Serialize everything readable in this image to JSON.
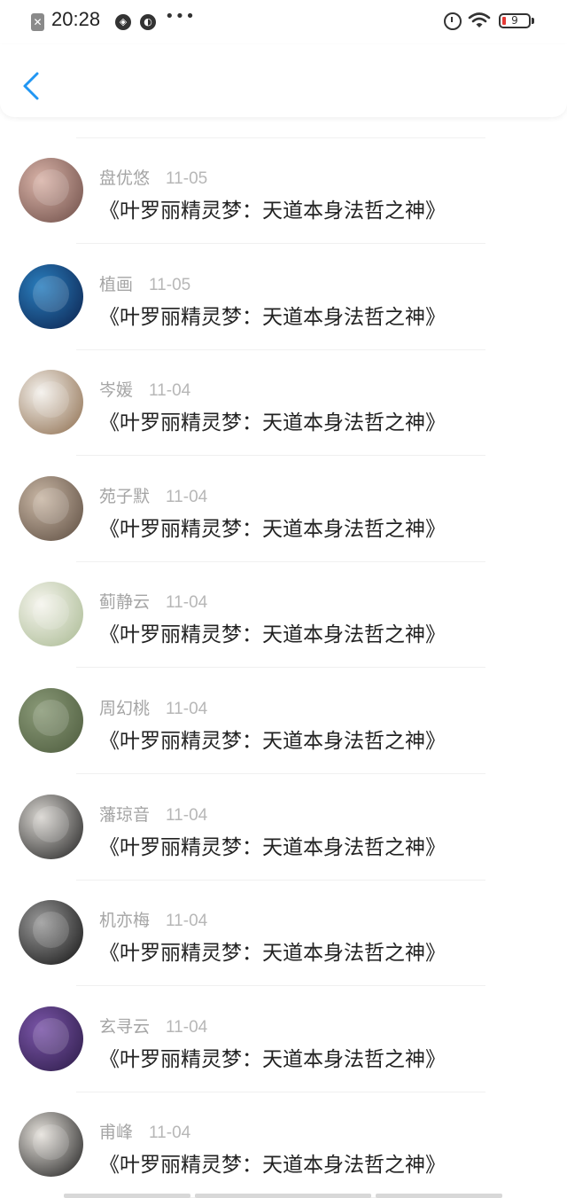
{
  "status_bar": {
    "time": "20:28",
    "battery": "9",
    "icons": [
      "close-notification-icon",
      "voice-icon",
      "compass-icon",
      "more-dots-icon",
      "alarm-icon",
      "wifi-icon",
      "battery-icon"
    ]
  },
  "nav": {
    "back_icon": "chevron-left-icon",
    "accent": "#2196f3"
  },
  "comments": [
    {
      "user": "盘优悠",
      "date": "11-05",
      "title": "《叶罗丽精灵梦：天道本身法哲之神》",
      "avatar_colors": [
        "#d9b3a8",
        "#6b4b45"
      ]
    },
    {
      "user": "植画",
      "date": "11-05",
      "title": "《叶罗丽精灵梦：天道本身法哲之神》",
      "avatar_colors": [
        "#2a7fbf",
        "#0b1f4a"
      ]
    },
    {
      "user": "岑媛",
      "date": "11-04",
      "title": "《叶罗丽精灵梦：天道本身法哲之神》",
      "avatar_colors": [
        "#f4f1ec",
        "#8b6a4a"
      ]
    },
    {
      "user": "苑子默",
      "date": "11-04",
      "title": "《叶罗丽精灵梦：天道本身法哲之神》",
      "avatar_colors": [
        "#c9b7a5",
        "#5a4a3e"
      ]
    },
    {
      "user": "蓟静云",
      "date": "11-04",
      "title": "《叶罗丽精灵梦：天道本身法哲之神》",
      "avatar_colors": [
        "#f6f5ee",
        "#a7b890"
      ]
    },
    {
      "user": "周幻桃",
      "date": "11-04",
      "title": "《叶罗丽精灵梦：天道本身法哲之神》",
      "avatar_colors": [
        "#8a9a78",
        "#4c5a3c"
      ]
    },
    {
      "user": "藩琼音",
      "date": "11-04",
      "title": "《叶罗丽精灵梦：天道本身法哲之神》",
      "avatar_colors": [
        "#d8d5d0",
        "#1d1d1d"
      ]
    },
    {
      "user": "机亦梅",
      "date": "11-04",
      "title": "《叶罗丽精灵梦：天道本身法哲之神》",
      "avatar_colors": [
        "#9a9a9a",
        "#111111"
      ]
    },
    {
      "user": "玄寻云",
      "date": "11-04",
      "title": "《叶罗丽精灵梦：天道本身法哲之神》",
      "avatar_colors": [
        "#7a55a8",
        "#2a1a45"
      ]
    },
    {
      "user": "甫峰",
      "date": "11-04",
      "title": "《叶罗丽精灵梦：天道本身法哲之神》",
      "avatar_colors": [
        "#e6e2dc",
        "#1a1a1a"
      ]
    }
  ]
}
